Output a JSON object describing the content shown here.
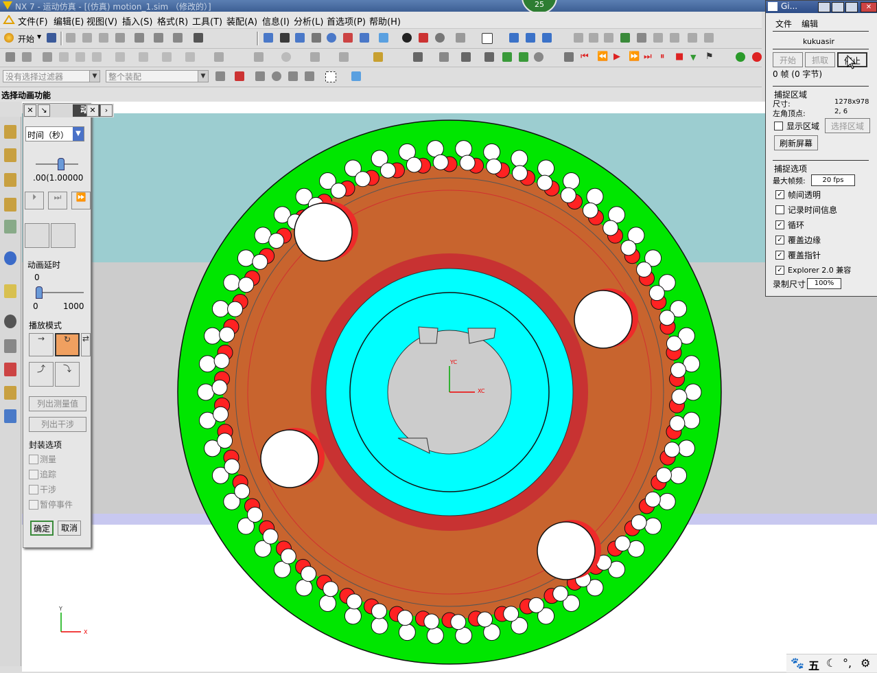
{
  "window": {
    "title": "NX 7 - 运动仿真 - [(仿真) motion_1.sim （修改的）]",
    "badge": "25"
  },
  "menu": [
    "文件(F)",
    "编辑(E)",
    "视图(V)",
    "插入(S)",
    "格式(R)",
    "工具(T)",
    "装配(A)",
    "信息(I)",
    "分析(L)",
    "首选项(P)",
    "帮助(H)"
  ],
  "toolbar": {
    "start_label": "开始",
    "filter_placeholder": "没有选择过滤器",
    "assembly_scope": "整个装配"
  },
  "prompt": "选择动画功能",
  "dialog": {
    "title": "动画",
    "time_mode": "时间（秒）",
    "time_readout": ".00(1.00000",
    "delay_label": "动画延时",
    "delay_value": "0",
    "delay_min": "0",
    "delay_max": "1000",
    "play_mode_label": "播放模式",
    "list_measure": "列出测量值",
    "list_interference": "列出干涉",
    "package_label": "封装选项",
    "options": [
      "测量",
      "追踪",
      "干涉",
      "暂停事件"
    ],
    "ok": "确定",
    "cancel": "取消"
  },
  "capture": {
    "title": "Gi...",
    "menu_file": "文件",
    "menu_edit": "编辑",
    "author": "kukuasir",
    "btn_start": "开始",
    "btn_grab": "抓取",
    "btn_stop": "停止",
    "frames": "0 帧 (0 字节)",
    "region_header": "捕捉区域",
    "size_label": "尺寸:",
    "size_value": "1278x978",
    "corner_label": "左角顶点:",
    "corner_value": "2, 6",
    "show_region": "显示区域",
    "select_region": "选择区域",
    "refresh": "刷新屏幕",
    "options_header": "捕捉选项",
    "fps_label": "最大帧频:",
    "fps_value": "20 fps",
    "opt_transparent": "帧间透明",
    "opt_time": "记录时间信息",
    "opt_loop": "循环",
    "opt_edge": "覆盖边缘",
    "opt_pointer": "覆盖指针",
    "opt_explorer": "Explorer 2.0 兼容",
    "rec_size_label": "录制尺寸",
    "rec_size_value": "100%"
  },
  "axes": {
    "x": "X",
    "y": "Y",
    "wcs_x": "XC",
    "wcs_y": "YC"
  },
  "tray": [
    "五"
  ],
  "colors": {
    "outer_ring": "#00e600",
    "carrier": "#c8642e",
    "red_ring": "#c83232",
    "cyan_ring": "#00ffff",
    "hub": "#cccccc",
    "sky": "#9ccdd0",
    "floor": "#cccccc"
  }
}
